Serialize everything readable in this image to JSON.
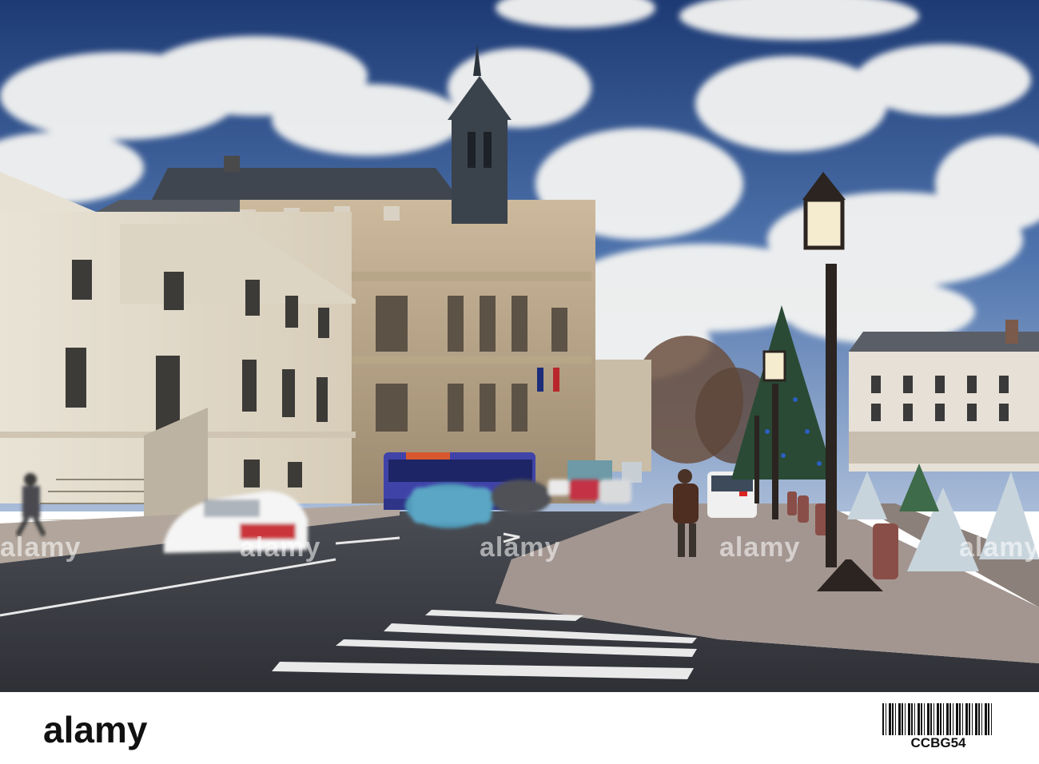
{
  "watermarks": [
    "alamy",
    "alamy",
    "alamy",
    "alamy",
    "alamy"
  ],
  "footer": {
    "logo": "alamy",
    "image_code": "CCBG54"
  },
  "bus": {
    "destination_display": ""
  },
  "colors": {
    "sky_top": "#1f3e78",
    "sky_mid": "#5d7fb4",
    "cloud": "#f2f2f0",
    "stone": "#d8c8ae",
    "facade_light": "#ece6da",
    "roof_slate": "#3d4550",
    "road": "#3a3d44",
    "sidewalk": "#9a8e88",
    "bus_blue": "#3c3c9a",
    "car_white_red": "#c9363a",
    "lamp_iron": "#2b2420"
  }
}
